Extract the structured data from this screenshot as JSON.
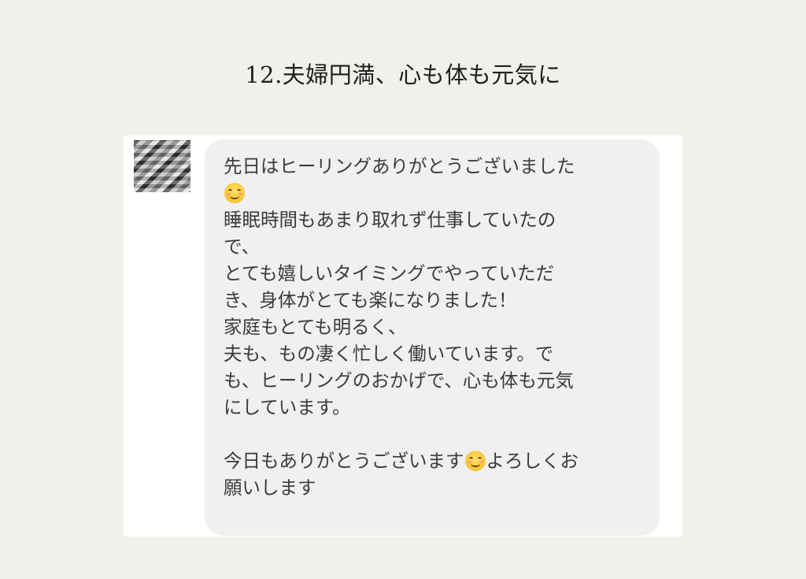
{
  "page": {
    "title": "12.夫婦円満、心も体も元気に"
  },
  "message": {
    "emoji": "smiling-face-with-smiling-eyes",
    "lines": [
      "先日はヒーリングありがとうございました",
      "",
      "睡眠時間もあまり取れず仕事していたの",
      "で、",
      "とても嬉しいタイミングでやっていただ",
      "き、身体がとても楽になりました！",
      "家庭もとても明るく、",
      "夫も、もの凄く忙しく働いています。で",
      "も、ヒーリングのおかげで、心も体も元気",
      "にしています。",
      "",
      "今日もありがとうございます",
      "よろしくお",
      "願いします"
    ]
  },
  "colors": {
    "page_background": "#f2f0eb",
    "bubble_background": "#f0f0f3",
    "text": "#3b3b3b"
  }
}
